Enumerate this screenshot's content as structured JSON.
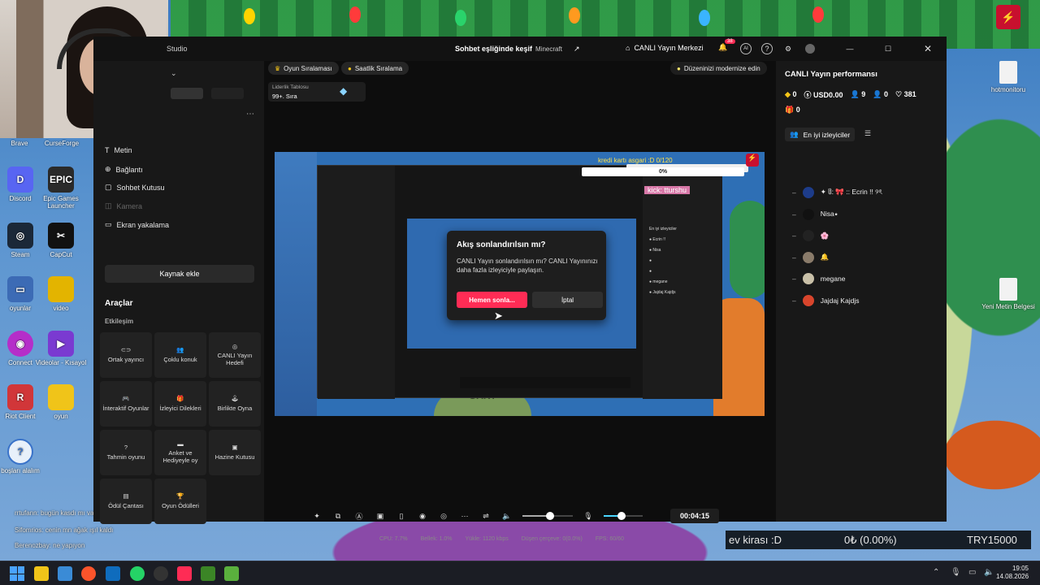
{
  "desktop": {
    "icons": [
      {
        "label": "Brave",
        "color": "#fb542b"
      },
      {
        "label": "CurseForge",
        "color": "#f16436"
      },
      {
        "label": "Discord",
        "color": "#5865f2"
      },
      {
        "label": "Epic Games Launcher",
        "color": "#2a2a2a"
      },
      {
        "label": "Steam",
        "color": "#1b2838"
      },
      {
        "label": "CapCut",
        "color": "#111"
      },
      {
        "label": "oyunlar",
        "color": "#3c6bb5"
      },
      {
        "label": "video",
        "color": "#e3b400"
      },
      {
        "label": "Connect",
        "color": "#b52ec9"
      },
      {
        "label": "Videolar - Kısayol",
        "color": "#7a3ad1"
      },
      {
        "label": "Riot Client",
        "color": "#d13639"
      },
      {
        "label": "oyun",
        "color": "#f0c419"
      },
      {
        "label": "boşları alalım",
        "color": "#3a73c9"
      }
    ],
    "right_icons": [
      {
        "label": "hotmonitoru"
      },
      {
        "label": "Yeni Metin Belgesi"
      }
    ],
    "chat_lines": [
      "rrtufann: bugün kasdı mı var",
      "Sifomrios: cenin mn ağak ışıl kaldı",
      "Berenozbay: ne yapıyon"
    ]
  },
  "app": {
    "title": "Sohbet eşliğinde keşif",
    "category": "Minecraft",
    "brand": "Studio",
    "live_center": "CANLI Yayın Merkezi",
    "notif_count": "38",
    "left_menu": [
      {
        "label": "Metin",
        "icon": "text-icon"
      },
      {
        "label": "Bağlantı",
        "icon": "link-icon"
      },
      {
        "label": "Sohbet Kutusu",
        "icon": "chat-icon"
      },
      {
        "label": "Kamera",
        "icon": "camera-icon"
      },
      {
        "label": "Ekran yakalama",
        "icon": "screen-icon"
      }
    ],
    "add_source": "Kaynak ekle",
    "tools_title": "Araçlar",
    "tools_section": "Etkileşim",
    "tools": [
      {
        "label": "Ortak yayıncı"
      },
      {
        "label": "Çoklu konuk"
      },
      {
        "label": "CANLI Yayın Hedefi"
      },
      {
        "label": "İnteraktif Oyunlar"
      },
      {
        "label": "İzleyici Dilekleri"
      },
      {
        "label": "Birlikte Oyna"
      },
      {
        "label": "Tahmin oyunu"
      },
      {
        "label": "Anket ve Hediyeyle oy"
      },
      {
        "label": "Hazine Kutusu"
      },
      {
        "label": "Ödül Çantası"
      },
      {
        "label": "Oyun Ödülleri"
      }
    ],
    "rank_tabs": [
      "Oyun Sıralaması",
      "Saatlik Sıralama"
    ],
    "leaderboard_label": "Liderlik Tablosu",
    "leaderboard_rank": "99+. Sıra",
    "modernize": "Düzeninizi modernize edin",
    "preview_overlay": {
      "goal": "kredi kartı asgari :D  0/120",
      "percent": "0%",
      "kick": "kick: tturshu"
    },
    "dialog": {
      "title": "Akış sonlandırılsın mı?",
      "body": "CANLI Yayın sonlandırılsın mı? CANLI Yayınınızı daha fazla izleyiciyle paylaşın.",
      "confirm": "Hemen sonla...",
      "cancel": "İptal"
    },
    "timer": "00:04:15",
    "stats": {
      "cpu": "CPU: 7.7%",
      "memory": "Bellek: 1.0%",
      "upload": "Yükle: 1120 kbps",
      "dropped": "Düşen çerçeve: 0(0.0%)",
      "fps": "FPS: 60/60"
    },
    "volume_levels": {
      "speaker": 0.55,
      "mic": 0.45
    },
    "perf": {
      "title": "CANLI Yayın performansı",
      "diamonds": "0",
      "usd": "USD0.00",
      "viewers": "9",
      "new_followers": "0",
      "likes": "381",
      "gifts": "0"
    },
    "top_viewers_title": "En iyi izleyiciler",
    "viewers": [
      {
        "name": "✦ ჱ: 🎀 :: Ecrin !! ୨ৎ",
        "color": "#1d3c8a"
      },
      {
        "name": "Nisa⭑",
        "color": "#111"
      },
      {
        "name": "🌸",
        "color": "#222"
      },
      {
        "name": "🔔",
        "color": "#8a7b6a"
      },
      {
        "name": "megane",
        "color": "#c9c0a8"
      },
      {
        "name": "Jajdaj Kajdjs",
        "color": "#d8452c"
      }
    ]
  },
  "overlay_bar": {
    "label": "ev kirası :D",
    "amount": "0₺ (0.00%)",
    "goal": "TRY15000"
  },
  "taskbar": {
    "time": "19:05",
    "date": "14.08.2026"
  },
  "colors": {
    "accent": "#fe2c55",
    "app_bg": "#121212",
    "panel": "#181818"
  }
}
